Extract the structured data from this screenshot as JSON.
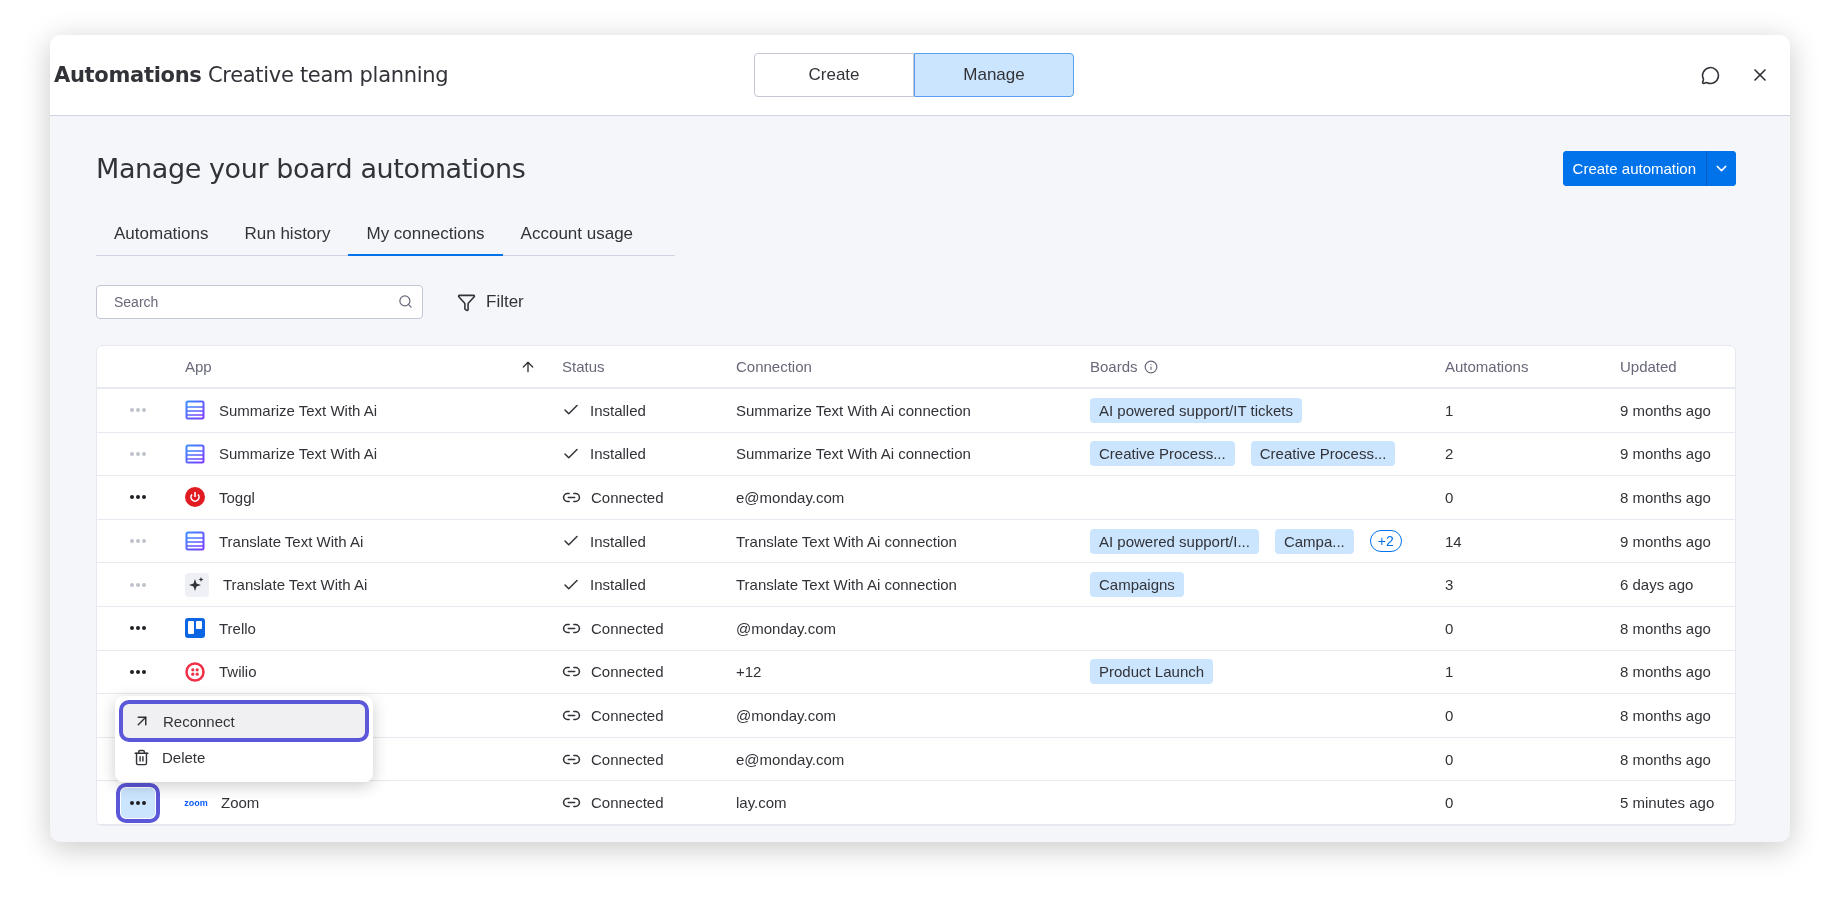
{
  "header": {
    "title": "**Automations** Creative team planning",
    "modes": [
      {
        "label": "Create",
        "selected": false
      },
      {
        "label": "Manage",
        "selected": true
      }
    ]
  },
  "page_title": "Manage your board automations",
  "create_button": "Create automation",
  "tabs": [
    {
      "label": "Automations",
      "selected": false
    },
    {
      "label": "Run history",
      "selected": false
    },
    {
      "label": "My connections",
      "selected": true
    },
    {
      "label": "Account usage",
      "selected": false
    }
  ],
  "search": {
    "placeholder": "Search"
  },
  "filter": "Filter",
  "table": {
    "columns": [
      "App",
      "Status",
      "Connection",
      "Boards",
      "Automations",
      "Updated"
    ],
    "rows": [
      {
        "disabled": true,
        "active": false,
        "kind": "list",
        "app": "Summarize Text With Ai",
        "status": {
          "kind": "installed",
          "label": "Installed"
        },
        "connection": "Summarize Text With Ai connection",
        "boards": [
          "AI powered support/IT tickets"
        ],
        "automations": "1",
        "updated": "9 months ago"
      },
      {
        "disabled": true,
        "active": false,
        "kind": "list",
        "app": "Summarize Text With Ai",
        "status": {
          "kind": "installed",
          "label": "Installed"
        },
        "connection": "Summarize Text With Ai connection",
        "boards": [
          "Creative Process...",
          "Creative Process..."
        ],
        "automations": "2",
        "updated": "9 months ago"
      },
      {
        "disabled": false,
        "active": false,
        "kind": "power",
        "app": "Toggl",
        "status": {
          "kind": "connected",
          "label": "Connected"
        },
        "connection": "e@monday.com",
        "automations": "0",
        "updated": "8 months ago"
      },
      {
        "disabled": true,
        "active": false,
        "kind": "list",
        "app": "Translate Text With Ai",
        "status": {
          "kind": "installed",
          "label": "Installed"
        },
        "connection": "Translate Text With Ai connection",
        "boards": [
          "AI powered support/I...",
          "Campa..."
        ],
        "more": "+2",
        "automations": "14",
        "updated": "9 months ago"
      },
      {
        "disabled": true,
        "active": false,
        "kind": "sparkle",
        "app": "Translate Text With Ai",
        "status": {
          "kind": "installed",
          "label": "Installed"
        },
        "connection": "Translate Text With Ai connection",
        "boards": [
          "Campaigns"
        ],
        "automations": "3",
        "updated": "6 days ago"
      },
      {
        "disabled": false,
        "active": false,
        "kind": "board",
        "app": "Trello",
        "status": {
          "kind": "connected",
          "label": "Connected"
        },
        "connection": "@monday.com",
        "automations": "0",
        "updated": "8 months ago"
      },
      {
        "disabled": false,
        "active": false,
        "kind": "dots-circle",
        "app": "Twilio",
        "status": {
          "kind": "connected",
          "label": "Connected"
        },
        "connection": "+12",
        "boards": [
          "Product Launch"
        ],
        "automations": "1",
        "updated": "8 months ago"
      },
      {
        "status": {
          "kind": "connected",
          "label": "Connected"
        },
        "connection": "@monday.com",
        "automations": "0",
        "updated": "8 months ago"
      },
      {
        "status": {
          "kind": "connected",
          "label": "Connected"
        },
        "connection": "e@monday.com",
        "automations": "0",
        "updated": "8 months ago"
      },
      {
        "disabled": false,
        "active": true,
        "kind": "wordmark",
        "logo_text": "zoom",
        "app": "Zoom",
        "status": {
          "kind": "connected",
          "label": "Connected"
        },
        "connection": "lay.com",
        "automations": "0",
        "updated": "5 minutes ago"
      }
    ]
  },
  "menu": {
    "items": [
      {
        "kind": "reconnect",
        "label": "Reconnect",
        "selected": true
      },
      {
        "kind": "delete",
        "label": "Delete",
        "selected": false
      }
    ]
  }
}
